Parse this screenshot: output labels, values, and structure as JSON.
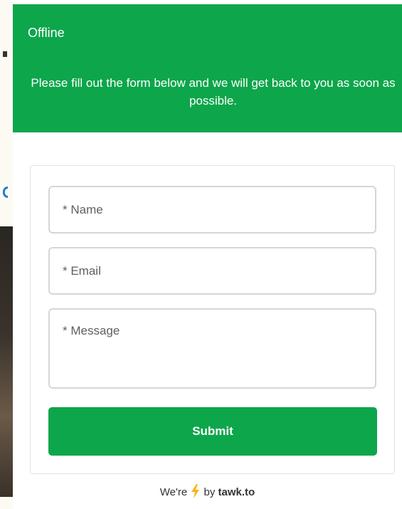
{
  "header": {
    "status": "Offline",
    "message": "Please fill out the form below and we will get back to you as soon as possible."
  },
  "form": {
    "name_placeholder": "* Name",
    "email_placeholder": "* Email",
    "message_placeholder": "* Message",
    "submit_label": "Submit"
  },
  "footer": {
    "prefix": "We're",
    "bolt_icon": "lightning-bolt",
    "by": "by",
    "brand": "tawk.to"
  },
  "colors": {
    "primary": "#0da64b",
    "bolt": "#f5b51a"
  }
}
